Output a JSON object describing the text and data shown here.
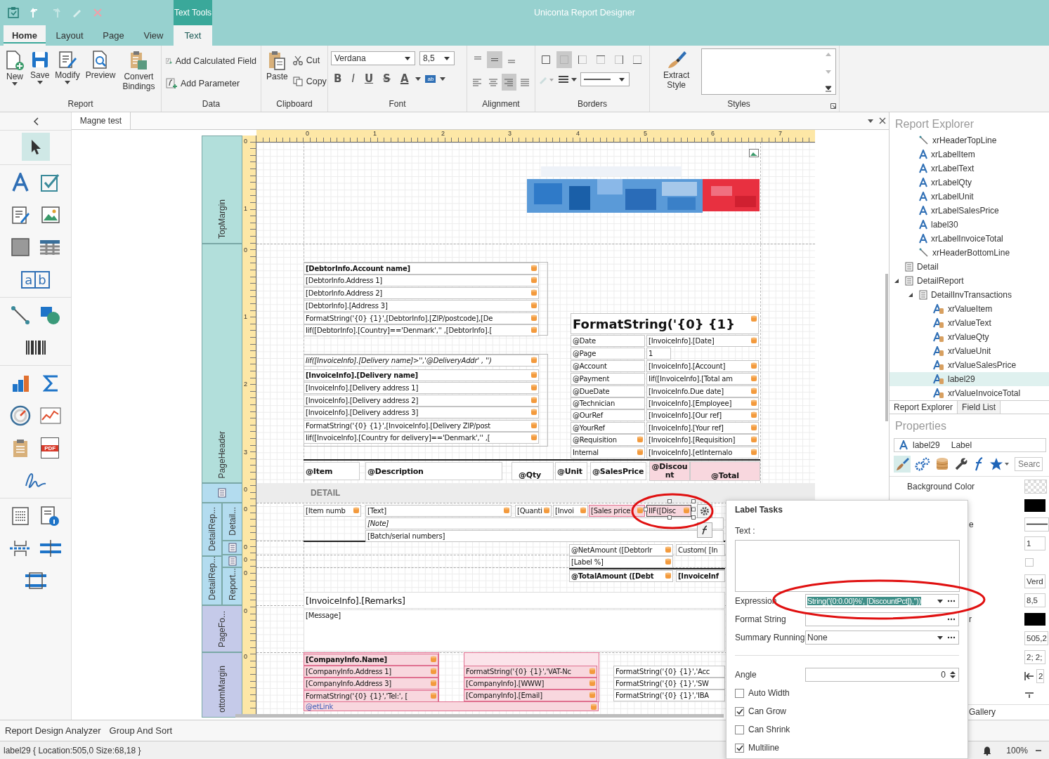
{
  "window": {
    "title": "Uniconta Report Designer",
    "context_tab": "Text Tools"
  },
  "tabs": [
    {
      "label": "Home",
      "selected": true,
      "kind": "standard"
    },
    {
      "label": "Layout",
      "selected": false,
      "kind": "standard"
    },
    {
      "label": "Page",
      "selected": false,
      "kind": "standard"
    },
    {
      "label": "View",
      "selected": false,
      "kind": "standard"
    },
    {
      "label": "Text",
      "selected": false,
      "kind": "contextual"
    }
  ],
  "ribbon": {
    "report": {
      "label": "Report",
      "buttons": [
        {
          "label": "New",
          "dropdown": true
        },
        {
          "label": "Save",
          "dropdown": true
        },
        {
          "label": "Modify",
          "dropdown": true
        },
        {
          "label": "Preview",
          "dropdown": false
        },
        {
          "label": "Convert Bindings",
          "dropdown": false
        }
      ]
    },
    "data": {
      "label": "Data",
      "buttons": [
        "Add Calculated Field",
        "Add Parameter"
      ]
    },
    "clipboard": {
      "label": "Clipboard",
      "paste": "Paste",
      "cut": "Cut",
      "copy": "Copy"
    },
    "font": {
      "label": "Font",
      "family": "Verdana",
      "size": "8,5",
      "styles": [
        "B",
        "I",
        "U",
        "S"
      ],
      "color_button": "A",
      "highlight": "ab"
    },
    "alignment": {
      "label": "Alignment",
      "vertical": [
        {
          "selected": false
        },
        {
          "selected": true
        },
        {
          "selected": false
        }
      ],
      "horizontal": [
        {
          "selected": false
        },
        {
          "selected": false
        },
        {
          "selected": true
        },
        {
          "selected": false
        }
      ]
    },
    "borders": {
      "label": "Borders",
      "sides": [
        {
          "selected": false
        },
        {
          "selected": true
        },
        {
          "selected": false
        },
        {
          "selected": false
        },
        {
          "selected": false
        },
        {
          "selected": false
        }
      ]
    },
    "styles": {
      "label": "Styles",
      "extract": "Extract Style"
    }
  },
  "toolbox": {
    "comb_letters": [
      "a",
      "b"
    ],
    "pdf_label": "PDF"
  },
  "document": {
    "tab": "Magne test",
    "detail_caption": "DETAIL",
    "ruler": [
      "0",
      "1",
      "2",
      "3",
      "4",
      "5",
      "6",
      "7"
    ],
    "vruler": [
      "0",
      "1",
      "0",
      "1",
      "2",
      "3",
      "0",
      "0",
      "0",
      "0",
      "0",
      "0",
      "0"
    ],
    "bands": [
      {
        "label": "TopMargin",
        "color": "#b2dfdb"
      },
      {
        "label": "PageHeader",
        "color": "#b2dfdb"
      },
      {
        "kind": "icon",
        "color": "#b3dcef"
      },
      {
        "label": "DetailRep...",
        "color": "#b3dcef"
      },
      {
        "label": "Detail...",
        "color": "#b3dcef"
      },
      {
        "kind": "icon",
        "color": "#b3dcef"
      },
      {
        "label": "DetailRep...",
        "color": "#b3dcef"
      },
      {
        "kind": "icon",
        "color": "#b3dcef"
      },
      {
        "label": "Report...",
        "color": "#b3dcef"
      },
      {
        "label": "PageFo...",
        "color": "#c5cae9"
      },
      {
        "label": "ottomMargin",
        "color": "#c5cae9"
      }
    ],
    "controls": [
      {
        "text": "[DebtorInfo.Account name]",
        "kind": "text",
        "bold": true,
        "italic": false,
        "bound": true,
        "highlighted": false,
        "selected": false
      },
      {
        "text": "[DebtorInfo.Address 1]",
        "kind": "text",
        "bold": false,
        "italic": false,
        "bound": true,
        "highlighted": false,
        "selected": false
      },
      {
        "text": "[DebtorInfo.Address 2]",
        "kind": "text",
        "bold": false,
        "italic": false,
        "bound": true,
        "highlighted": false,
        "selected": false
      },
      {
        "text": "[DebtorInfo].[Address 3]",
        "kind": "text",
        "bold": false,
        "italic": false,
        "bound": true,
        "highlighted": false,
        "selected": false
      },
      {
        "text": "FormatString('{0} {1}',[DebtorInfo].[ZIP/postcode],[De",
        "kind": "text",
        "bold": false,
        "italic": false,
        "bound": true,
        "highlighted": false,
        "selected": false
      },
      {
        "text": "Iif([DebtorInfo].[Country]=='Denmark','' ,[DebtorInfo].[",
        "kind": "text",
        "bold": false,
        "italic": false,
        "bound": true,
        "highlighted": false,
        "selected": false
      },
      {
        "text": "Iif([InvoiceInfo].[Delivery name]>'','@DeliveryAddr' , '')",
        "kind": "text",
        "bold": false,
        "italic": true,
        "bound": true,
        "highlighted": false,
        "selected": false
      },
      {
        "text": "[InvoiceInfo].[Delivery name]",
        "kind": "text",
        "bold": true,
        "italic": false,
        "bound": true,
        "highlighted": false,
        "selected": false
      },
      {
        "text": "[InvoiceInfo].[Delivery address 1]",
        "kind": "text",
        "bold": false,
        "italic": false,
        "bound": true,
        "highlighted": false,
        "selected": false
      },
      {
        "text": "[InvoiceInfo].[Delivery address 2]",
        "kind": "text",
        "bold": false,
        "italic": false,
        "bound": true,
        "highlighted": false,
        "selected": false
      },
      {
        "text": "[InvoiceInfo].[Delivery address 3]",
        "kind": "text",
        "bold": false,
        "italic": false,
        "bound": true,
        "highlighted": false,
        "selected": false
      },
      {
        "text": "FormatString('{0} {1}',[InvoiceInfo].[Delivery ZIP/post",
        "kind": "text",
        "bold": false,
        "italic": false,
        "bound": true,
        "highlighted": false,
        "selected": false
      },
      {
        "text": "Iif([InvoiceInfo].[Country for delivery]=='Denmark','' ,[",
        "kind": "text",
        "bold": false,
        "italic": false,
        "bound": true,
        "highlighted": false,
        "selected": false
      },
      {
        "text": "FormatString('{0} {1}",
        "kind": "title",
        "bold": true,
        "italic": false,
        "bound": true,
        "highlighted": false,
        "selected": false
      },
      {
        "text": "@Date",
        "kind": "text",
        "bold": false,
        "italic": false,
        "bound": false,
        "highlighted": false,
        "selected": false
      },
      {
        "text": "[InvoiceInfo].[Date]",
        "kind": "text",
        "bold": false,
        "italic": false,
        "bound": true,
        "highlighted": false,
        "selected": false
      },
      {
        "text": "@Page",
        "kind": "text",
        "bold": false,
        "italic": false,
        "bound": false,
        "highlighted": false,
        "selected": false
      },
      {
        "text": "1",
        "kind": "text",
        "bold": false,
        "italic": false,
        "bound": false,
        "highlighted": false,
        "selected": false
      },
      {
        "text": "@Account",
        "kind": "text",
        "bold": false,
        "italic": false,
        "bound": false,
        "highlighted": false,
        "selected": false
      },
      {
        "text": "[InvoiceInfo].[Account]",
        "kind": "text",
        "bold": false,
        "italic": false,
        "bound": true,
        "highlighted": false,
        "selected": false
      },
      {
        "text": "@Payment",
        "kind": "text",
        "bold": false,
        "italic": false,
        "bound": false,
        "highlighted": false,
        "selected": false
      },
      {
        "text": "Iif([InvoiceInfo].[Total am",
        "kind": "text",
        "bold": false,
        "italic": false,
        "bound": true,
        "highlighted": false,
        "selected": false
      },
      {
        "text": "@DueDate",
        "kind": "text",
        "bold": false,
        "italic": false,
        "bound": false,
        "highlighted": false,
        "selected": false
      },
      {
        "text": "[InvoiceInfo.Due date]",
        "kind": "text",
        "bold": false,
        "italic": false,
        "bound": true,
        "highlighted": false,
        "selected": false
      },
      {
        "text": "@Technician",
        "kind": "text",
        "bold": false,
        "italic": false,
        "bound": false,
        "highlighted": false,
        "selected": false
      },
      {
        "text": "[InvoiceInfo].[Employee]",
        "kind": "text",
        "bold": false,
        "italic": false,
        "bound": true,
        "highlighted": false,
        "selected": false
      },
      {
        "text": "@OurRef",
        "kind": "text",
        "bold": false,
        "italic": false,
        "bound": false,
        "highlighted": false,
        "selected": false
      },
      {
        "text": "[InvoiceInfo].[Our ref]",
        "kind": "text",
        "bold": false,
        "italic": false,
        "bound": true,
        "highlighted": false,
        "selected": false
      },
      {
        "text": "@YourRef",
        "kind": "text",
        "bold": false,
        "italic": false,
        "bound": false,
        "highlighted": false,
        "selected": false
      },
      {
        "text": "[InvoiceInfo].[Your ref]",
        "kind": "text",
        "bold": false,
        "italic": false,
        "bound": true,
        "highlighted": false,
        "selected": false
      },
      {
        "text": "@Requisition",
        "kind": "text",
        "bold": false,
        "italic": false,
        "bound": true,
        "highlighted": false,
        "selected": false
      },
      {
        "text": "[InvoiceInfo].[Requisition]",
        "kind": "text",
        "bold": false,
        "italic": false,
        "bound": true,
        "highlighted": false,
        "selected": false
      },
      {
        "text": "Internal",
        "kind": "text",
        "bold": false,
        "italic": false,
        "bound": true,
        "highlighted": false,
        "selected": false
      },
      {
        "text": "[InvoiceInfo].[etInternalo",
        "kind": "text",
        "bold": false,
        "italic": false,
        "bound": true,
        "highlighted": false,
        "selected": false
      },
      {
        "text": "@Item",
        "kind": "header",
        "bold": true,
        "italic": false,
        "bound": false,
        "highlighted": false,
        "selected": false
      },
      {
        "text": "@Description",
        "kind": "header",
        "bold": true,
        "italic": false,
        "bound": false,
        "highlighted": false,
        "selected": false
      },
      {
        "text": "@Qty",
        "kind": "header",
        "bold": true,
        "italic": false,
        "bound": false,
        "highlighted": false,
        "selected": false
      },
      {
        "text": "@Unit",
        "kind": "header",
        "bold": true,
        "italic": false,
        "bound": false,
        "highlighted": false,
        "selected": false
      },
      {
        "text": "@SalesPrice",
        "kind": "header",
        "bold": true,
        "italic": false,
        "bound": false,
        "highlighted": false,
        "selected": false
      },
      {
        "text": "@Discount",
        "kind": "header",
        "bold": true,
        "italic": false,
        "bound": false,
        "highlighted": true,
        "selected": false
      },
      {
        "text": "@Total",
        "kind": "header",
        "bold": true,
        "italic": false,
        "bound": false,
        "highlighted": true,
        "selected": false
      },
      {
        "text": "[Item numb",
        "kind": "text",
        "bold": false,
        "italic": false,
        "bound": true,
        "highlighted": false,
        "selected": false
      },
      {
        "text": "[Text]",
        "kind": "text",
        "bold": false,
        "italic": false,
        "bound": true,
        "highlighted": false,
        "selected": false
      },
      {
        "text": "[Quanti",
        "kind": "text",
        "bold": false,
        "italic": false,
        "bound": true,
        "highlighted": false,
        "selected": false
      },
      {
        "text": "[Invoi",
        "kind": "text",
        "bold": false,
        "italic": false,
        "bound": true,
        "highlighted": false,
        "selected": false
      },
      {
        "text": "[Sales price",
        "kind": "text",
        "bold": false,
        "italic": false,
        "bound": true,
        "highlighted": true,
        "selected": false
      },
      {
        "text": "IIF([Disc",
        "kind": "text",
        "bold": false,
        "italic": false,
        "bound": true,
        "highlighted": true,
        "selected": true
      },
      {
        "text": "[Note]",
        "kind": "text",
        "bold": false,
        "italic": true,
        "bound": false,
        "highlighted": false,
        "selected": false
      },
      {
        "text": "[Batch/serial numbers]",
        "kind": "text",
        "bold": false,
        "italic": false,
        "bound": false,
        "highlighted": false,
        "selected": false
      },
      {
        "text": "@NetAmount ([DebtorIr",
        "kind": "text",
        "bold": false,
        "italic": false,
        "bound": true,
        "highlighted": false,
        "selected": false
      },
      {
        "text": "Custom( [In",
        "kind": "text",
        "bold": false,
        "italic": false,
        "bound": false,
        "highlighted": false,
        "selected": false
      },
      {
        "text": "[Label %]",
        "kind": "text",
        "bold": false,
        "italic": false,
        "bound": true,
        "highlighted": false,
        "selected": false
      },
      {
        "text": "@TotalAmount ([Debt",
        "kind": "text",
        "bold": true,
        "italic": false,
        "bound": true,
        "highlighted": false,
        "selected": false
      },
      {
        "text": "[InvoiceInf",
        "kind": "text",
        "bold": true,
        "italic": false,
        "bound": false,
        "highlighted": false,
        "selected": false
      },
      {
        "text": "[InvoiceInfo].[Remarks]",
        "kind": "large",
        "bold": false,
        "italic": false,
        "bound": false,
        "highlighted": false,
        "selected": false
      },
      {
        "text": "[Message]",
        "kind": "memo",
        "bold": false,
        "italic": false,
        "bound": false,
        "highlighted": false,
        "selected": false
      },
      {
        "text": "[CompanyInfo.Name]",
        "kind": "text",
        "bold": true,
        "italic": false,
        "bound": true,
        "highlighted": true,
        "selected": false
      },
      {
        "text": "[CompanyInfo.Address 1]",
        "kind": "text",
        "bold": false,
        "italic": false,
        "bound": true,
        "highlighted": true,
        "selected": false
      },
      {
        "text": "[CompanyInfo.Address 3]",
        "kind": "text",
        "bold": false,
        "italic": false,
        "bound": true,
        "highlighted": true,
        "selected": false
      },
      {
        "text": "FormatString('{0} {1}','Tel:', [",
        "kind": "text",
        "bold": false,
        "italic": false,
        "bound": true,
        "highlighted": true,
        "selected": false
      },
      {
        "text": "FormatString('{0} {1}','VAT-Nc",
        "kind": "text",
        "bold": false,
        "italic": false,
        "bound": true,
        "highlighted": true,
        "selected": false
      },
      {
        "text": "[CompanyInfo].[WWW]",
        "kind": "text",
        "bold": false,
        "italic": false,
        "bound": true,
        "highlighted": true,
        "selected": false
      },
      {
        "text": "[CompanyInfo].[Email]",
        "kind": "text",
        "bold": false,
        "italic": false,
        "bound": true,
        "highlighted": true,
        "selected": false
      },
      {
        "text": "FormatString('{0} {1}','Acc",
        "kind": "text",
        "bold": false,
        "italic": false,
        "bound": false,
        "highlighted": false,
        "selected": false
      },
      {
        "text": "FormatString('{0} {1}','SW",
        "kind": "text",
        "bold": false,
        "italic": false,
        "bound": false,
        "highlighted": false,
        "selected": false
      },
      {
        "text": "FormatString('{0} {1}','IBA",
        "kind": "text",
        "bold": false,
        "italic": false,
        "bound": false,
        "highlighted": false,
        "selected": false
      },
      {
        "text": "@etLink",
        "kind": "link",
        "bold": false,
        "italic": false,
        "bound": true,
        "highlighted": true,
        "selected": false
      }
    ]
  },
  "explorer": {
    "title": "Report Explorer",
    "tree": [
      {
        "children": [
          {
            "label": "xrHeaderTopLine",
            "kind": "line",
            "selected": false
          },
          {
            "label": "xrLabelItem",
            "kind": "label",
            "selected": false
          },
          {
            "label": "xrLabelText",
            "kind": "label",
            "selected": false
          },
          {
            "label": "xrLabelQty",
            "kind": "label",
            "selected": false
          },
          {
            "label": "xrLabelUnit",
            "kind": "label",
            "selected": false
          },
          {
            "label": "xrLabelSalesPrice",
            "kind": "label",
            "selected": false
          },
          {
            "label": "label30",
            "kind": "label",
            "selected": false
          },
          {
            "label": "xrLabelInvoiceTotal",
            "kind": "label",
            "selected": false
          },
          {
            "label": "xrHeaderBottomLine",
            "kind": "line",
            "selected": false
          }
        ]
      },
      {
        "label": "Detail",
        "kind": "band",
        "selected": false
      },
      {
        "label": "DetailReport",
        "kind": "band",
        "selected": false,
        "expanded": true,
        "children": [
          {
            "label": "DetailInvTransactions",
            "kind": "band",
            "selected": false,
            "expanded": true,
            "children": [
              {
                "label": "xrValueItem",
                "kind": "bound-label",
                "selected": false
              },
              {
                "label": "xrValueText",
                "kind": "bound-label",
                "selected": false
              },
              {
                "label": "xrValueQty",
                "kind": "bound-label",
                "selected": false
              },
              {
                "label": "xrValueUnit",
                "kind": "bound-label",
                "selected": false
              },
              {
                "label": "xrValueSalesPrice",
                "kind": "bound-label",
                "selected": false
              },
              {
                "label": "label29",
                "kind": "bound-label",
                "selected": true
              },
              {
                "label": "xrValueInvoiceTotal",
                "kind": "bound-label",
                "selected": false
              }
            ]
          }
        ]
      }
    ],
    "tabs": [
      {
        "label": "Report Explorer",
        "selected": true
      },
      {
        "label": "Field List",
        "selected": false
      }
    ]
  },
  "properties": {
    "title": "Properties",
    "object": {
      "name": "label29",
      "type": "Label"
    },
    "tools": [
      {
        "selected": true
      },
      {
        "selected": false
      },
      {
        "selected": false
      },
      {
        "selected": false
      },
      {
        "selected": false
      },
      {
        "selected": false
      }
    ],
    "search": {
      "placeholder": "Searc"
    },
    "rows": [
      {
        "label": "Background Color",
        "kind": "checker"
      },
      {
        "kind": "swatch"
      },
      {
        "label": "e",
        "kind": "line"
      },
      {
        "kind": "text",
        "value": "1"
      },
      {
        "kind": "icons"
      },
      {
        "kind": "text",
        "value": "Verd"
      },
      {
        "kind": "text",
        "value": "8,5"
      },
      {
        "label": "r",
        "kind": "swatch"
      },
      {
        "kind": "text",
        "value": "505,2"
      },
      {
        "kind": "text",
        "value": "2; 2;"
      },
      {
        "kind": "anchor",
        "value": "2"
      },
      {
        "kind": "anchor2"
      }
    ],
    "gallery": "Gallery"
  },
  "tasks": {
    "title": "Label Tasks",
    "text_label": "Text :",
    "fields": [
      {
        "label": "Expression",
        "value": "String('{0:0.00}%', [DiscountPct]),''))",
        "kind": "expression"
      },
      {
        "label": "Format String",
        "kind": "ellipsis"
      },
      {
        "label": "Summary Running",
        "value": "None",
        "kind": "combo"
      }
    ],
    "angle": {
      "label": "Angle",
      "value": "0"
    },
    "options": [
      {
        "label": "Auto Width",
        "checked": false
      },
      {
        "label": "Can Grow",
        "checked": true
      },
      {
        "label": "Can Shrink",
        "checked": false
      },
      {
        "label": "Multiline",
        "checked": true
      }
    ]
  },
  "bottom_tabs": [
    "Report Design Analyzer",
    "Group And Sort"
  ],
  "status": {
    "text": "label29 { Location:505,0 Size:68,18 }",
    "zoom": "100%"
  }
}
